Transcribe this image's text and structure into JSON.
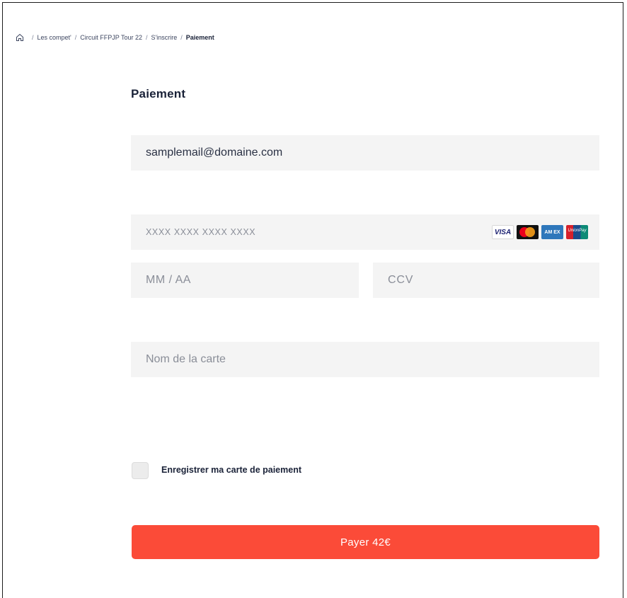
{
  "breadcrumb": {
    "items": [
      "Les compet'",
      "Circuit FFPJP Tour 22",
      "S'inscrire"
    ],
    "current": "Paiement"
  },
  "page_title": "Paiement",
  "form": {
    "email_value": "samplemail@domaine.com",
    "card_number_placeholder": "XXXX XXXX XXXX XXXX",
    "expiry_placeholder": "MM / AA",
    "ccv_placeholder": "CCV",
    "card_name_placeholder": "Nom de la carte",
    "card_logos": {
      "visa": "VISA",
      "amex": "AM EX",
      "unionpay": "UnionPay"
    }
  },
  "save_card_label": "Enregistrer ma carte de paiement",
  "save_card_checked": false,
  "pay_button_label": "Payer 42€",
  "colors": {
    "accent": "#fb4b38",
    "field_bg": "#f4f4f4",
    "text_dark": "#1a2238"
  }
}
